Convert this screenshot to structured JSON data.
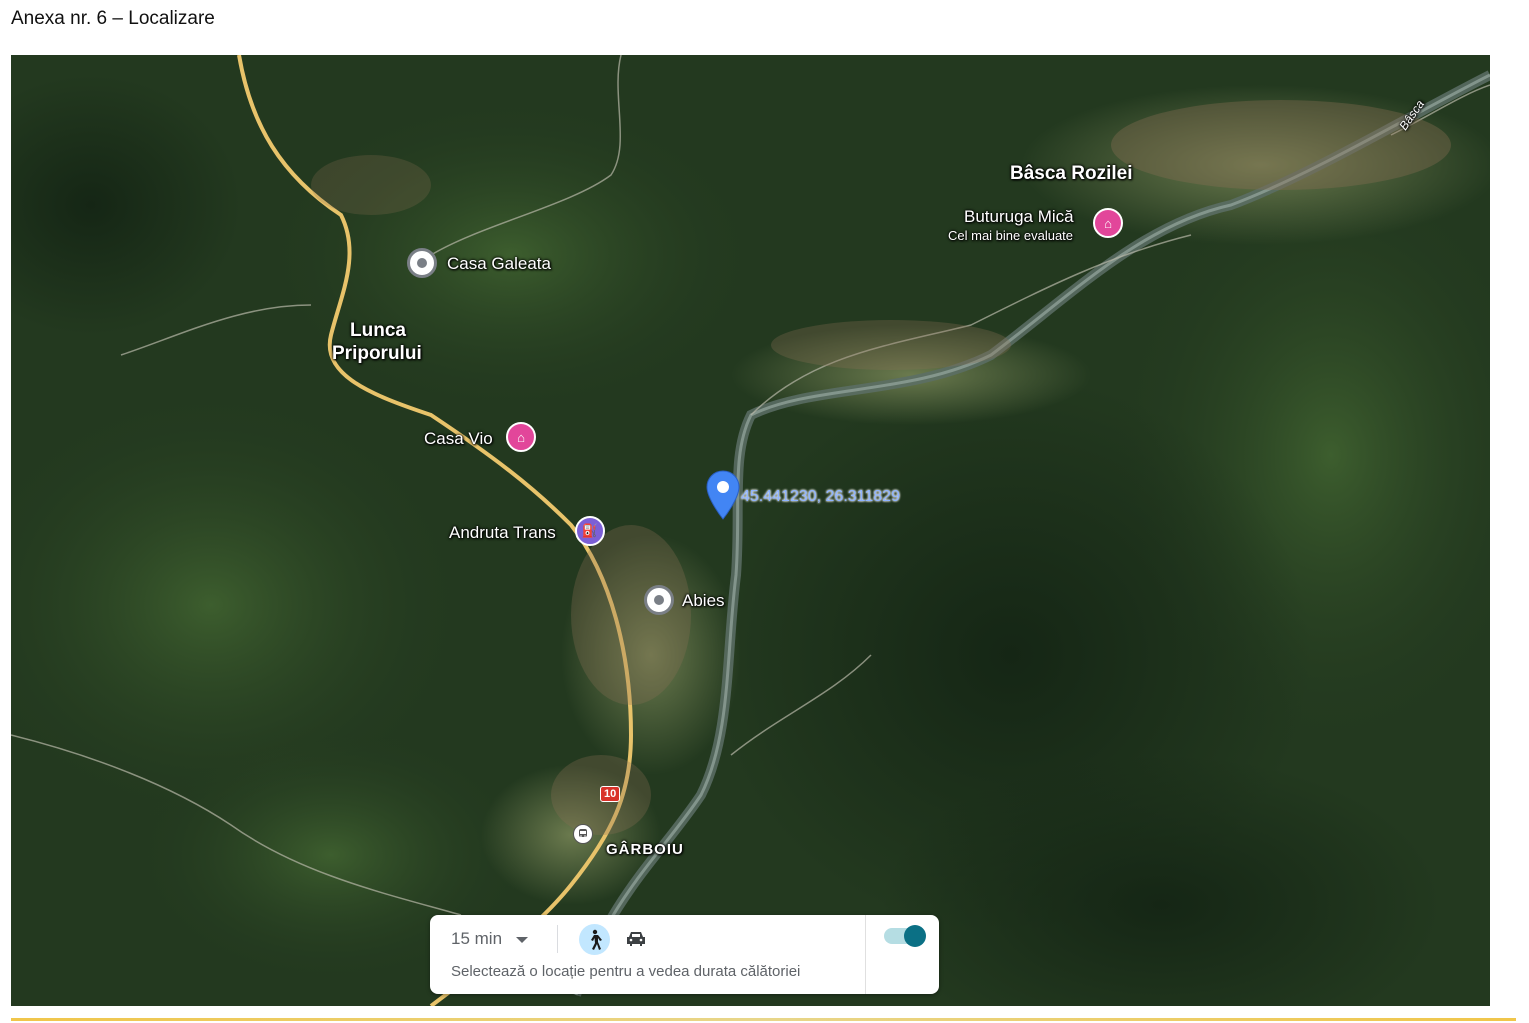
{
  "document": {
    "title": "Anexa nr. 6 – Localizare"
  },
  "map": {
    "labels": {
      "lunca_line1": "Lunca",
      "lunca_line2": "Priporului",
      "basca_rozilei": "Bâsca Rozilei",
      "garboiu": "GÂRBOIU",
      "basca_road": "Bâsca"
    },
    "places": [
      {
        "name": "Casa Galeata",
        "type": "point-of-interest"
      },
      {
        "name": "Casa Vio",
        "type": "hotel"
      },
      {
        "name": "Andruta Trans",
        "type": "fuel-station"
      },
      {
        "name": "Abies",
        "type": "point-of-interest"
      },
      {
        "name": "Buturuga Mică",
        "subtitle": "Cel mai bine evaluate",
        "type": "hotel"
      }
    ],
    "dropped_pin": {
      "label": "45.441230, 26.311829",
      "lat": 45.44123,
      "lng": 26.311829,
      "color": "#4285f4"
    },
    "route_shield": "10",
    "icons": [
      "hotel-icon",
      "fuel-pump-icon",
      "transit-icon",
      "location-pin-icon",
      "walking-icon",
      "car-icon"
    ]
  },
  "travel_panel": {
    "time": "15 min",
    "hint": "Selectează o locație pentru a vedea durata călătoriei",
    "mode_selected": "walking",
    "toggle_on": true
  },
  "colors": {
    "forest": "#23391f",
    "road": "#e8c36a",
    "hotel": "#e2469a",
    "fuel": "#7c5fd6",
    "accent_line": "#f0c64a"
  }
}
